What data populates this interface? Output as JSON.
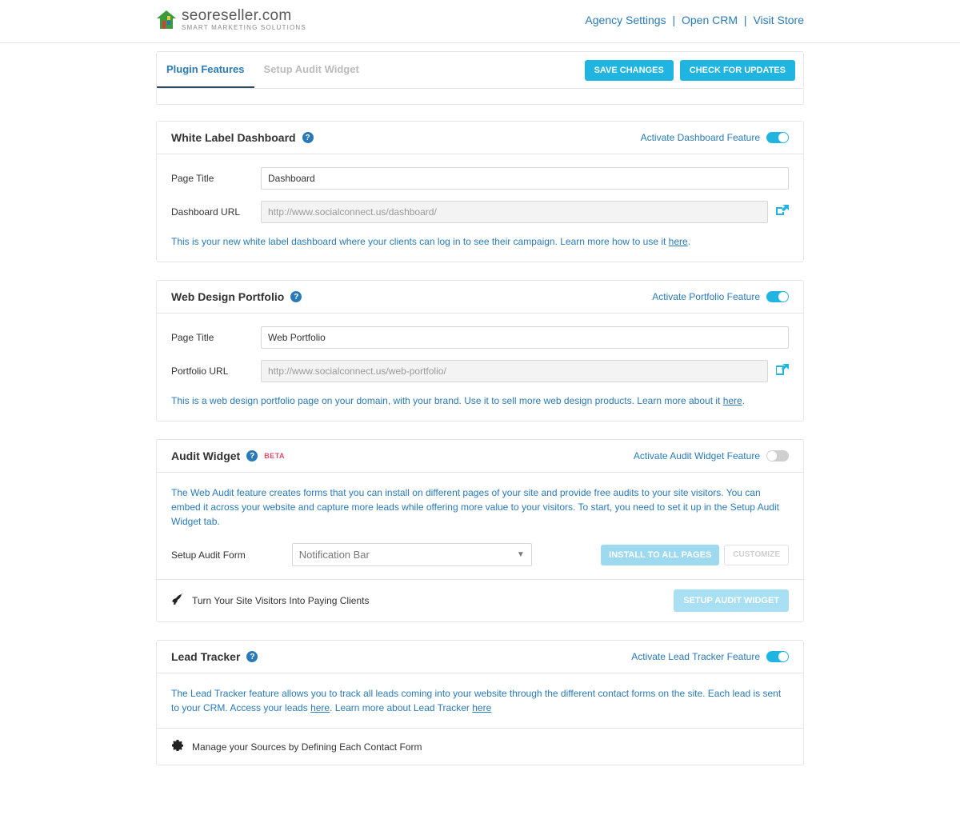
{
  "header": {
    "brand": "seoreseller.com",
    "tagline": "SMART MARKETING SOLUTIONS",
    "links": {
      "agency": "Agency Settings",
      "crm": "Open CRM",
      "store": "Visit Store"
    }
  },
  "tabs": {
    "plugin": "Plugin Features",
    "setup": "Setup Audit Widget",
    "save": "SAVE CHANGES",
    "check": "CHECK FOR UPDATES"
  },
  "dashboard": {
    "title": "White Label Dashboard",
    "activate_label": "Activate Dashboard Feature",
    "page_title_label": "Page Title",
    "page_title_value": "Dashboard",
    "url_label": "Dashboard URL",
    "url_value": "http://www.socialconnect.us/dashboard/",
    "desc_pre": "This is your new white label dashboard where your clients can log in to see their campaign. Learn more how to use it ",
    "desc_link": "here",
    "desc_post": "."
  },
  "portfolio": {
    "title": "Web Design Portfolio",
    "activate_label": "Activate Portfolio Feature",
    "page_title_label": "Page Title",
    "page_title_value": "Web Portfolio",
    "url_label": "Portfolio URL",
    "url_value": "http://www.socialconnect.us/web-portfolio/",
    "desc_pre": "This is a web design portfolio page on your domain, with your brand. Use it to sell more web design products. Learn more about it ",
    "desc_link": "here",
    "desc_post": "."
  },
  "audit": {
    "title": "Audit Widget",
    "beta": "BETA",
    "activate_label": "Activate Audit Widget Feature",
    "desc": "The Web Audit feature creates forms that you can install on different pages of your site and provide free audits to your site visitors. You can embed it across your website and capture more leads while offering more value to your visitors. To start, you need to set it up in the Setup Audit Widget tab.",
    "form_label": "Setup Audit Form",
    "select_value": "Notification Bar",
    "install_btn": "INSTALL TO ALL PAGES",
    "customize_btn": "CUSTOMIZE",
    "footer_text": "Turn Your Site Visitors Into Paying Clients",
    "setup_btn": "SETUP AUDIT WIDGET"
  },
  "lead": {
    "title": "Lead Tracker",
    "activate_label": "Activate Lead Tracker Feature",
    "desc_pre": "The Lead Tracker feature allows you to track all leads coming into your website through the different contact forms on the site. Each lead is sent to your CRM. Access your leads ",
    "desc_link1": "here",
    "desc_mid": ". Learn more about Lead Tracker ",
    "desc_link2": "here",
    "footer_text": "Manage your Sources by Defining Each Contact Form"
  }
}
